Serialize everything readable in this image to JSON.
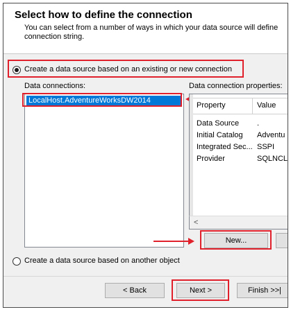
{
  "header": {
    "title": "Select how to define the connection",
    "subtitle": "You can select from a number of ways in which your data source will define connection string."
  },
  "options": {
    "existing": {
      "label": "Create a data source based on an existing or new connection",
      "selected": true
    },
    "object": {
      "label": "Create a data source based on another object",
      "selected": false
    }
  },
  "connections": {
    "label": "Data connections:",
    "items": [
      "LocalHost.AdventureWorksDW2014"
    ],
    "selected_index": 0
  },
  "properties": {
    "label": "Data connection properties:",
    "columns": [
      "Property",
      "Value"
    ],
    "rows": [
      {
        "property": "Data Source",
        "value": "."
      },
      {
        "property": "Initial Catalog",
        "value": "Adventu"
      },
      {
        "property": "Integrated Sec...",
        "value": "SSPI"
      },
      {
        "property": "Provider",
        "value": "SQLNCL"
      }
    ]
  },
  "buttons": {
    "new": "New...",
    "back": "< Back",
    "next": "Next >",
    "finish": "Finish >>|"
  },
  "scrollbar": {
    "left_arrow": "<"
  },
  "colors": {
    "highlight": "#e0202a",
    "selection": "#0078d7"
  }
}
